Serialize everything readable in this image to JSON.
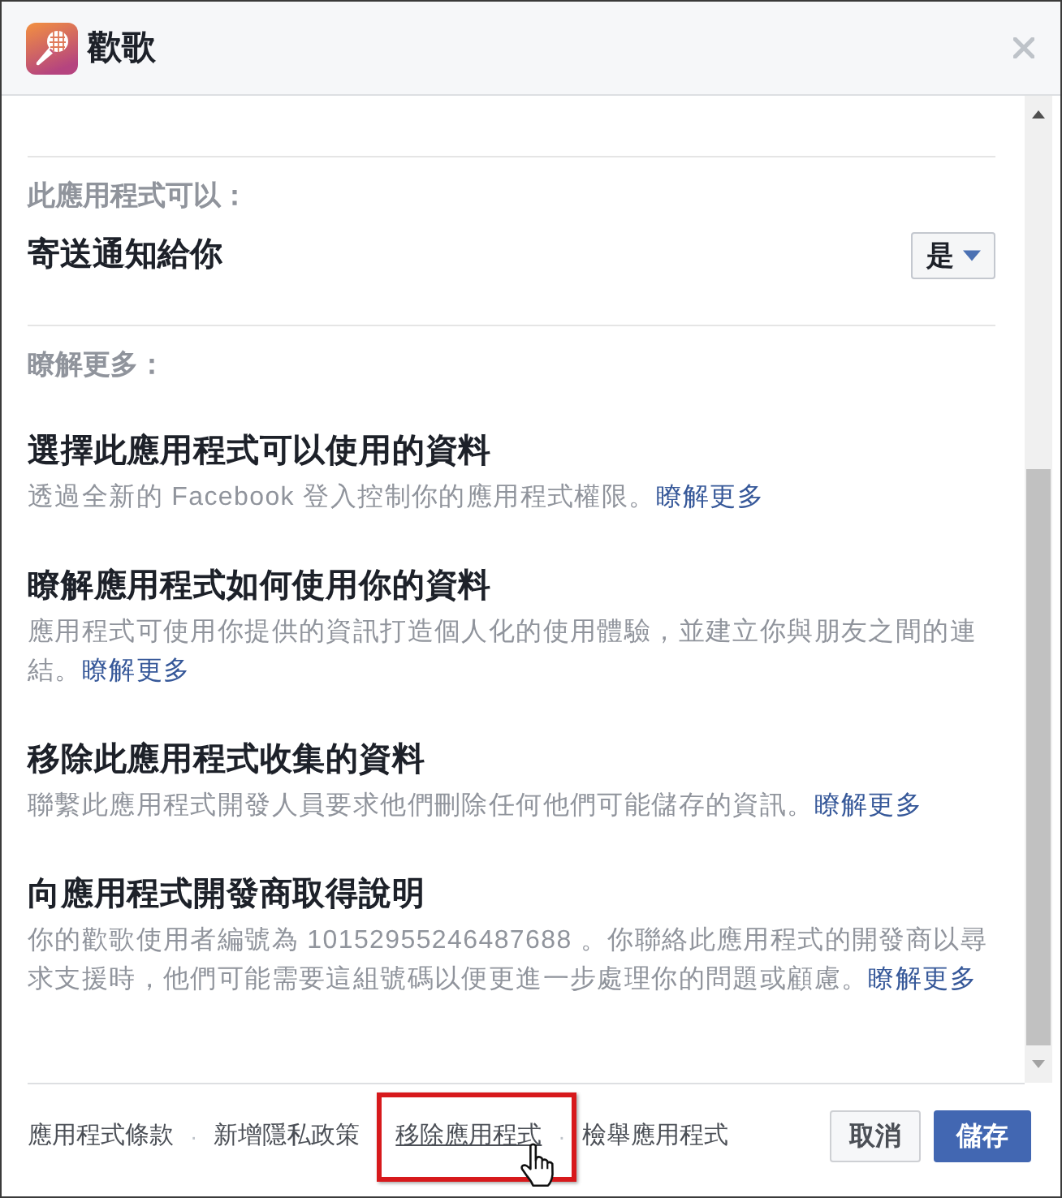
{
  "dialog": {
    "app_name": "歡歌"
  },
  "permissions": {
    "heading": "此應用程式可以：",
    "items": [
      {
        "label": "寄送通知給你",
        "dropdown": {
          "value": "是"
        }
      }
    ]
  },
  "learn_more": {
    "heading": "瞭解更多：",
    "sections": [
      {
        "title": "選擇此應用程式可以使用的資料",
        "description": "透過全新的 Facebook 登入控制你的應用程式權限。",
        "link": "瞭解更多"
      },
      {
        "title": "瞭解應用程式如何使用你的資料",
        "description": "應用程式可使用你提供的資訊打造個人化的使用體驗，並建立你與朋友之間的連結。",
        "link": "瞭解更多"
      },
      {
        "title": "移除此應用程式收集的資料",
        "description": "聯繫此應用程式開發人員要求他們刪除任何他們可能儲存的資訊。",
        "link": "瞭解更多"
      },
      {
        "title": "向應用程式開發商取得說明",
        "description": "你的歡歌使用者編號為 10152955246487688 。你聯絡此應用程式的開發商以尋求支援時，他們可能需要這組號碼以便更進一步處理你的問題或顧慮。",
        "link": "瞭解更多"
      }
    ]
  },
  "footer": {
    "links": [
      {
        "label": "應用程式條款",
        "hovered": false,
        "highlighted": false
      },
      {
        "separator": "·",
        "label": "新增隱私政策",
        "hovered": false,
        "highlighted": false
      },
      {
        "label": "移除應用程式",
        "hovered": true,
        "highlighted": true
      },
      {
        "separator": "·",
        "label": "檢舉應用程式",
        "hovered": false,
        "highlighted": false
      }
    ],
    "buttons": [
      {
        "label": "取消",
        "kind": "secondary"
      },
      {
        "label": "儲存",
        "kind": "primary"
      }
    ]
  }
}
